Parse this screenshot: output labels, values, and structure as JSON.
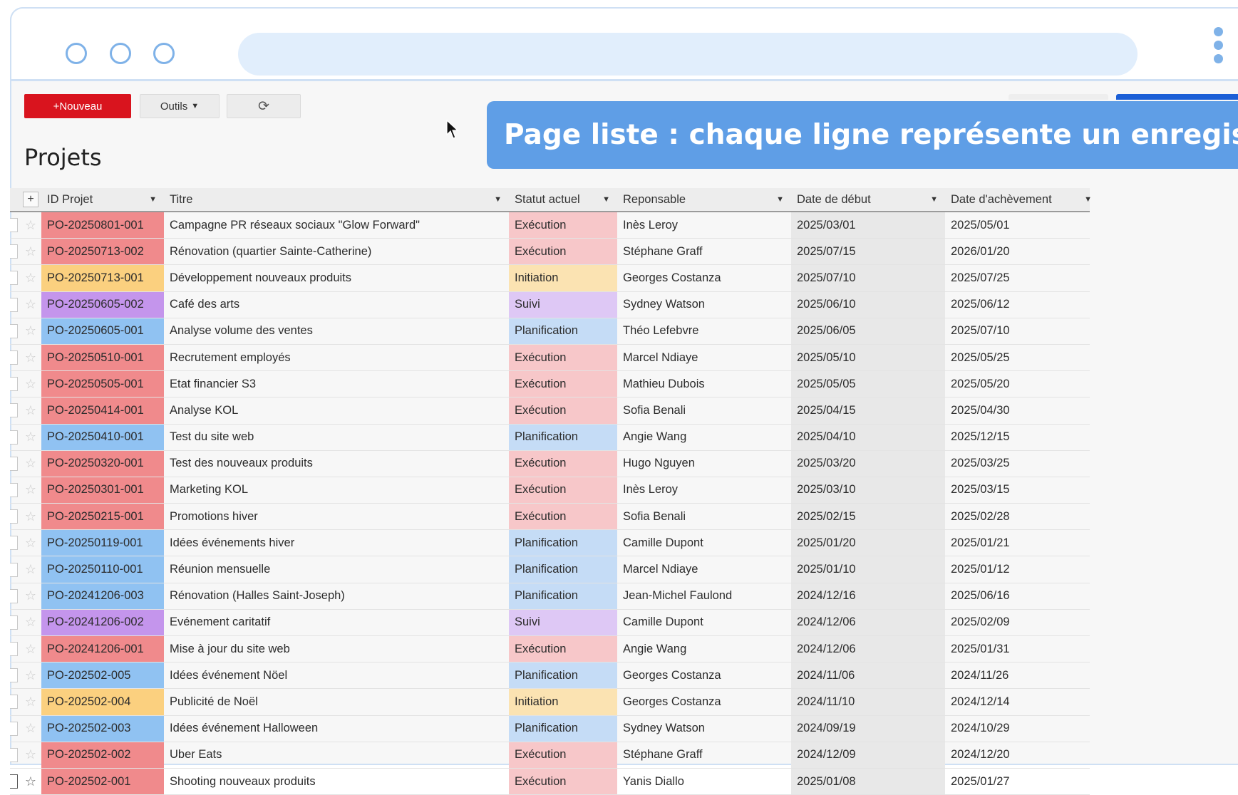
{
  "toolbar": {
    "new_label": "+Nouveau",
    "tools_label": "Outils",
    "refresh_icon": "refresh-icon"
  },
  "banner": {
    "text": "Page liste : chaque ligne représente un enregistrement"
  },
  "page": {
    "title": "Projets"
  },
  "table": {
    "columns": [
      "ID Projet",
      "Titre",
      "Statut actuel",
      "Reponsable",
      "Date de début",
      "Date d'achèvement"
    ],
    "rows": [
      {
        "id": "PO-20250801-001",
        "title": "Campagne PR réseaux sociaux \"Glow Forward\"",
        "status": "Exécution",
        "resp": "Inès Leroy",
        "start": "2025/03/01",
        "end": "2025/05/01",
        "kind": "exec"
      },
      {
        "id": "PO-20250713-002",
        "title": "Rénovation (quartier Sainte-Catherine)",
        "status": "Exécution",
        "resp": "Stéphane Graff",
        "start": "2025/07/15",
        "end": "2026/01/20",
        "kind": "exec"
      },
      {
        "id": "PO-20250713-001",
        "title": "Développement nouveaux produits",
        "status": "Initiation",
        "resp": "Georges Costanza",
        "start": "2025/07/10",
        "end": "2025/07/25",
        "kind": "init"
      },
      {
        "id": "PO-20250605-002",
        "title": "Café des arts",
        "status": "Suivi",
        "resp": "Sydney Watson",
        "start": "2025/06/10",
        "end": "2025/06/12",
        "kind": "suivi"
      },
      {
        "id": "PO-20250605-001",
        "title": "Analyse volume des ventes",
        "status": "Planification",
        "resp": "Théo Lefebvre",
        "start": "2025/06/05",
        "end": "2025/07/10",
        "kind": "plan"
      },
      {
        "id": "PO-20250510-001",
        "title": "Recrutement employés",
        "status": "Exécution",
        "resp": "Marcel Ndiaye",
        "start": "2025/05/10",
        "end": "2025/05/25",
        "kind": "exec"
      },
      {
        "id": "PO-20250505-001",
        "title": "Etat financier S3",
        "status": "Exécution",
        "resp": "Mathieu Dubois",
        "start": "2025/05/05",
        "end": "2025/05/20",
        "kind": "exec"
      },
      {
        "id": "PO-20250414-001",
        "title": "Analyse KOL",
        "status": "Exécution",
        "resp": "Sofia Benali",
        "start": "2025/04/15",
        "end": "2025/04/30",
        "kind": "exec"
      },
      {
        "id": "PO-20250410-001",
        "title": "Test du site web",
        "status": "Planification",
        "resp": "Angie Wang",
        "start": "2025/04/10",
        "end": "2025/12/15",
        "kind": "plan"
      },
      {
        "id": "PO-20250320-001",
        "title": "Test des nouveaux produits",
        "status": "Exécution",
        "resp": "Hugo Nguyen",
        "start": "2025/03/20",
        "end": "2025/03/25",
        "kind": "exec"
      },
      {
        "id": "PO-20250301-001",
        "title": "Marketing KOL",
        "status": "Exécution",
        "resp": "Inès Leroy",
        "start": "2025/03/10",
        "end": "2025/03/15",
        "kind": "exec"
      },
      {
        "id": "PO-20250215-001",
        "title": "Promotions hiver",
        "status": "Exécution",
        "resp": "Sofia Benali",
        "start": "2025/02/15",
        "end": "2025/02/28",
        "kind": "exec"
      },
      {
        "id": "PO-20250119-001",
        "title": "Idées événements hiver",
        "status": "Planification",
        "resp": "Camille Dupont",
        "start": "2025/01/20",
        "end": "2025/01/21",
        "kind": "plan"
      },
      {
        "id": "PO-20250110-001",
        "title": "Réunion mensuelle",
        "status": "Planification",
        "resp": "Marcel Ndiaye",
        "start": "2025/01/10",
        "end": "2025/01/12",
        "kind": "plan"
      },
      {
        "id": "PO-20241206-003",
        "title": "Rénovation (Halles Saint-Joseph)",
        "status": "Planification",
        "resp": "Jean-Michel Faulond",
        "start": "2024/12/16",
        "end": "2025/06/16",
        "kind": "plan"
      },
      {
        "id": "PO-20241206-002",
        "title": "Evénement caritatif",
        "status": "Suivi",
        "resp": "Camille Dupont",
        "start": "2024/12/06",
        "end": "2025/02/09",
        "kind": "suivi"
      },
      {
        "id": "PO-20241206-001",
        "title": "Mise à jour du site web",
        "status": "Exécution",
        "resp": "Angie Wang",
        "start": "2024/12/06",
        "end": "2025/01/31",
        "kind": "exec"
      },
      {
        "id": "PO-202502-005",
        "title": "Idées événement Nöel",
        "status": "Planification",
        "resp": "Georges Costanza",
        "start": "2024/11/06",
        "end": "2024/11/26",
        "kind": "plan"
      },
      {
        "id": "PO-202502-004",
        "title": "Publicité de Noël",
        "status": "Initiation",
        "resp": "Georges Costanza",
        "start": "2024/11/10",
        "end": "2024/12/14",
        "kind": "init"
      },
      {
        "id": "PO-202502-003",
        "title": "Idées événement Halloween",
        "status": "Planification",
        "resp": "Sydney Watson",
        "start": "2024/09/19",
        "end": "2024/10/29",
        "kind": "plan"
      },
      {
        "id": "PO-202502-002",
        "title": "Uber Eats",
        "status": "Exécution",
        "resp": "Stéphane Graff",
        "start": "2024/12/09",
        "end": "2024/12/20",
        "kind": "exec"
      },
      {
        "id": "PO-202502-001",
        "title": "Shooting nouveaux produits",
        "status": "Exécution",
        "resp": "Yanis Diallo",
        "start": "2025/01/08",
        "end": "2025/01/27",
        "kind": "exec"
      }
    ]
  },
  "colors": {
    "new_button": "#d9141e",
    "banner": "#5f9ee6",
    "execution": "#f08a8c",
    "planification": "#90c2f2",
    "initiation": "#fbd07f",
    "suivi": "#c495ec"
  }
}
